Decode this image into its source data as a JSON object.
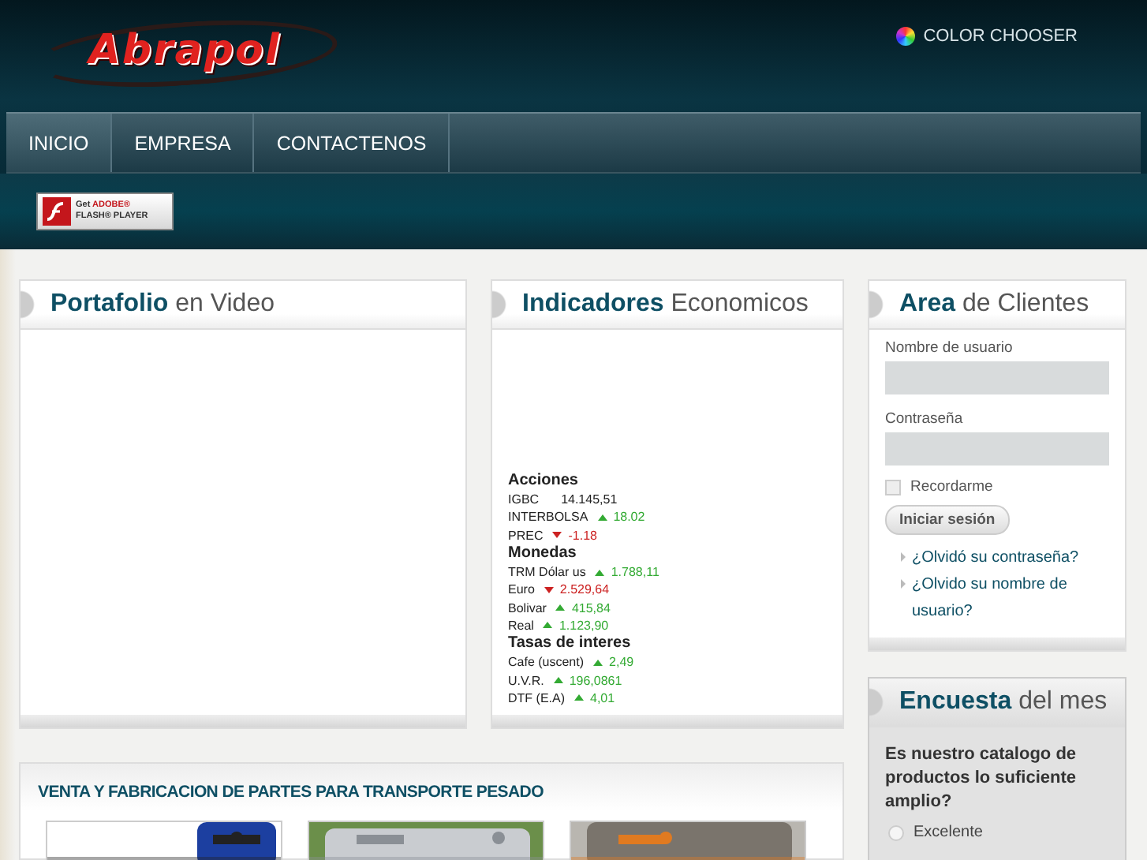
{
  "header": {
    "logo": "Abrapol",
    "color_chooser": "COLOR CHOOSER"
  },
  "nav": [
    {
      "label": "INICIO",
      "selected": true
    },
    {
      "label": "EMPRESA",
      "selected": false
    },
    {
      "label": "CONTACTENOS",
      "selected": false
    }
  ],
  "flash_badge": {
    "line_1": "Get",
    "brand": "ADOBE®",
    "line_2": "FLASH® PLAYER"
  },
  "portfolio": {
    "title_bold": "Portafolio",
    "title_rest": "en Video"
  },
  "indicators": {
    "title_bold": "Indicadores",
    "title_rest": "Economicos",
    "groups": [
      {
        "title": "Acciones",
        "items": [
          {
            "name": "IGBC",
            "value": "14.145,51",
            "kind": "plain"
          },
          {
            "name": "INTERBOLSA",
            "value": "18.02",
            "kind": "up"
          },
          {
            "name": "PREC",
            "value": "-1.18",
            "kind": "down"
          }
        ]
      },
      {
        "title": "Monedas",
        "items": [
          {
            "name": "TRM Dólar us",
            "value": "1.788,11",
            "kind": "up"
          },
          {
            "name": "Euro",
            "value": "2.529,64",
            "kind": "down"
          },
          {
            "name": "Bolivar",
            "value": "415,84",
            "kind": "up"
          },
          {
            "name": "Real",
            "value": "1.123,90",
            "kind": "up"
          }
        ]
      },
      {
        "title": "Tasas de interes",
        "items": [
          {
            "name": "Cafe (uscent)",
            "value": "2,49",
            "kind": "up"
          },
          {
            "name": "U.V.R.",
            "value": "196,0861",
            "kind": "up"
          },
          {
            "name": "DTF (E.A)",
            "value": "4,01",
            "kind": "up"
          }
        ]
      }
    ]
  },
  "clients": {
    "title_bold": "Area",
    "title_rest": "de Clientes",
    "username_label": "Nombre de usuario",
    "password_label": "Contraseña",
    "remember": {
      "label": "Recordarme",
      "checked": false
    },
    "login_button": "Iniciar sesión",
    "links": [
      "¿Olvidó su contraseña?",
      "¿Olvido su nombre de usuario?"
    ]
  },
  "poll": {
    "title_bold": "Encuesta",
    "title_rest": "del mes",
    "question": "Es nuestro catalogo de productos lo suficiente amplio?",
    "options": [
      {
        "label": "Excelente",
        "selected": false
      }
    ]
  },
  "products": {
    "title": "VENTA Y FABRICACION DE PARTES PARA TRANSPORTE PESADO"
  }
}
